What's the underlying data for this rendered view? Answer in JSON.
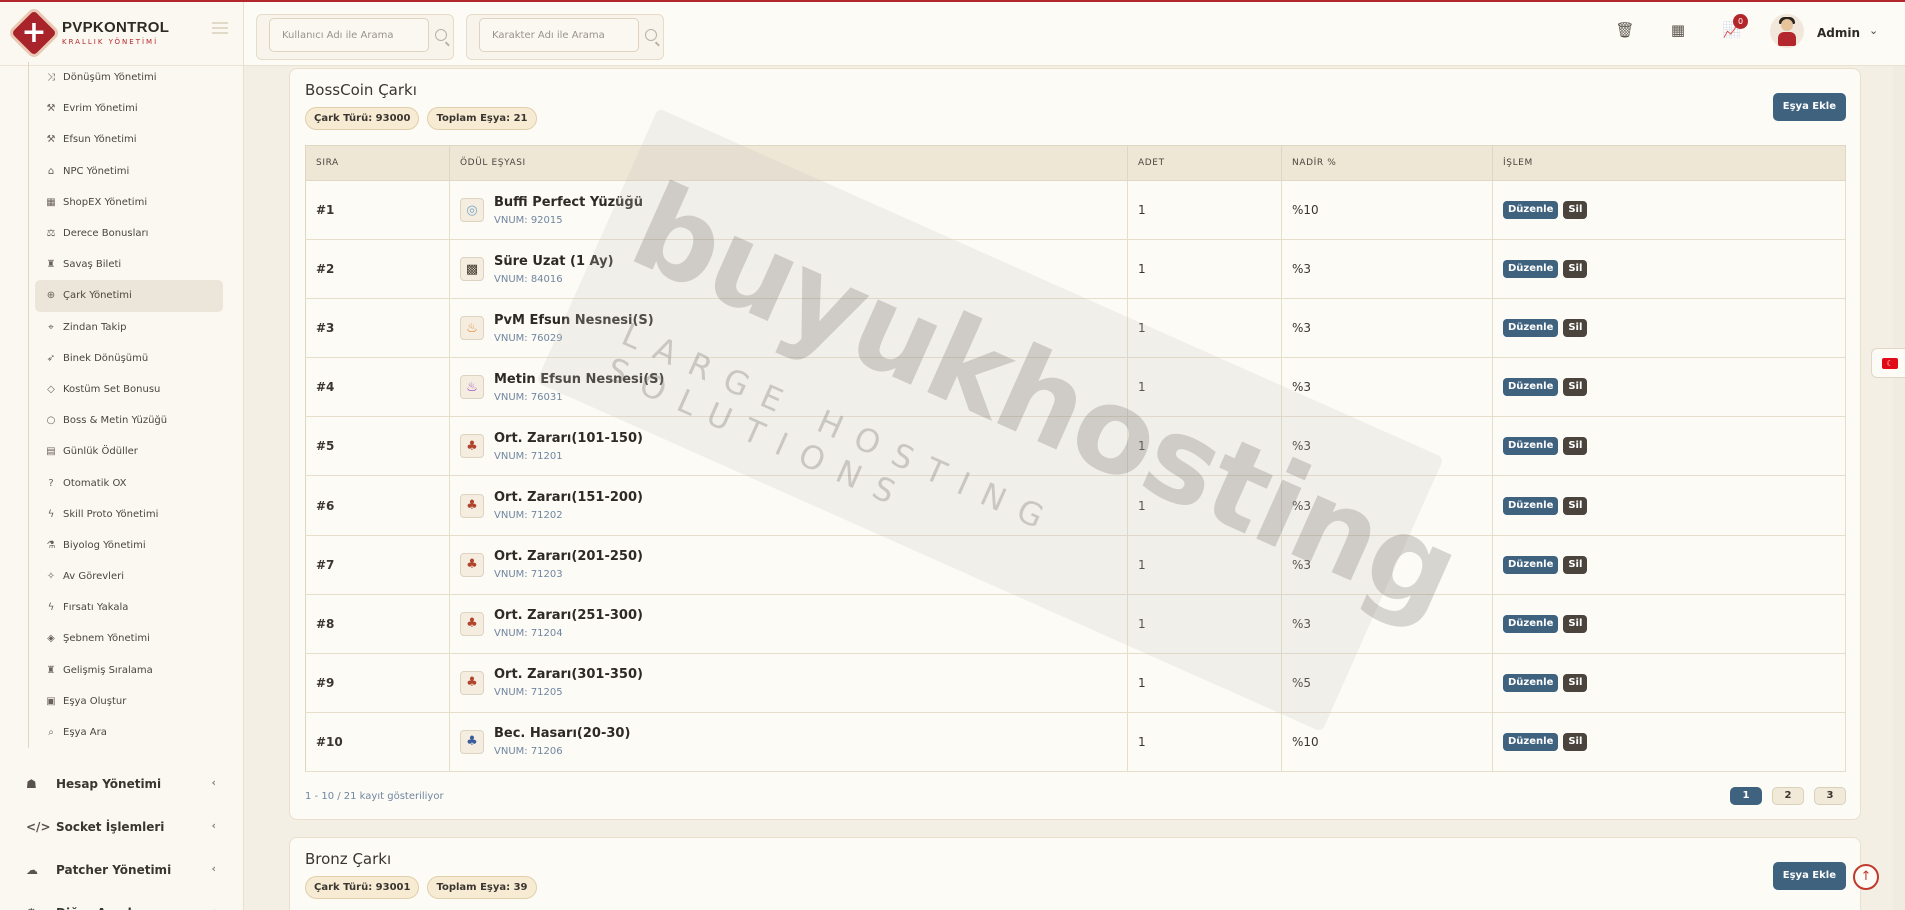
{
  "brand": {
    "name": "PVPKONTROL",
    "tagline": "KRALLIK YÖNETİMİ"
  },
  "search": {
    "user_placeholder": "Kullanıcı Adı ile Arama",
    "char_placeholder": "Karakter Adı ile Arama"
  },
  "header": {
    "notification_count": "0",
    "admin_name": "Admin"
  },
  "submenu": [
    {
      "label": "Dönüşüm Yönetimi",
      "icon": "shuffle-icon",
      "glyph": "⤨"
    },
    {
      "label": "Evrim Yönetimi",
      "icon": "wand-icon",
      "glyph": "⚒"
    },
    {
      "label": "Efsun Yönetimi",
      "icon": "wand-icon",
      "glyph": "⚒"
    },
    {
      "label": "NPC Yönetimi",
      "icon": "bank-icon",
      "glyph": "⌂"
    },
    {
      "label": "ShopEX Yönetimi",
      "icon": "shop-icon",
      "glyph": "▦"
    },
    {
      "label": "Derece Bonusları",
      "icon": "scale-icon",
      "glyph": "⚖"
    },
    {
      "label": "Savaş Bileti",
      "icon": "trophy-icon",
      "glyph": "♜"
    },
    {
      "label": "Çark Yönetimi",
      "icon": "globe-icon",
      "glyph": "⊕"
    },
    {
      "label": "Zindan Takip",
      "icon": "pin-icon",
      "glyph": "⌖"
    },
    {
      "label": "Binek Dönüşümü",
      "icon": "rocket-icon",
      "glyph": "➶"
    },
    {
      "label": "Kostüm Set Bonusu",
      "icon": "gem-icon",
      "glyph": "◇"
    },
    {
      "label": "Boss & Metin Yüzüğü",
      "icon": "ring-icon",
      "glyph": "○"
    },
    {
      "label": "Günlük Ödüller",
      "icon": "calendar-icon",
      "glyph": "▤"
    },
    {
      "label": "Otomatik OX",
      "icon": "question-icon",
      "glyph": "?"
    },
    {
      "label": "Skill Proto Yönetimi",
      "icon": "bolt-icon",
      "glyph": "ϟ"
    },
    {
      "label": "Biyolog Yönetimi",
      "icon": "flask-icon",
      "glyph": "⚗"
    },
    {
      "label": "Av Görevleri",
      "icon": "crosshair-icon",
      "glyph": "✧"
    },
    {
      "label": "Fırsatı Yakala",
      "icon": "bolt-icon",
      "glyph": "ϟ"
    },
    {
      "label": "Şebnem Yönetimi",
      "icon": "drop-icon",
      "glyph": "◈"
    },
    {
      "label": "Gelişmiş Sıralama",
      "icon": "trophy-icon",
      "glyph": "♜"
    },
    {
      "label": "Eşya Oluştur",
      "icon": "gift-icon",
      "glyph": "▣"
    },
    {
      "label": "Eşya Ara",
      "icon": "search-icon",
      "glyph": "⌕"
    }
  ],
  "active_submenu": "Çark Yönetimi",
  "mainmenu": [
    {
      "label": "Hesap Yönetimi",
      "icon": "users-icon",
      "glyph": "☗"
    },
    {
      "label": "Socket İşlemleri",
      "icon": "code-icon",
      "glyph": "</>"
    },
    {
      "label": "Patcher Yönetimi",
      "icon": "cloud-icon",
      "glyph": "☁"
    },
    {
      "label": "Diğer Ayarlar",
      "icon": "gear-icon",
      "glyph": "⚙"
    }
  ],
  "wheel1": {
    "title": "BossCoin Çarkı",
    "type_pill": "Çark Türü: 93000",
    "total_pill": "Toplam Eşya: 21",
    "add_label": "Eşya Ekle",
    "columns": [
      "SIRA",
      "ÖDÜL EŞYASI",
      "ADET",
      "NADİR %",
      "İŞLEM"
    ],
    "rows": [
      {
        "sira": "#1",
        "name": "Buffi Perfect Yüzüğü",
        "vnum": "VNUM: 92015",
        "adet": "1",
        "nadir": "%10",
        "icon": "ring-item-icon",
        "glyph": "◎",
        "color": "#7aa6c9"
      },
      {
        "sira": "#2",
        "name": "Süre Uzat (1 Ay)",
        "vnum": "VNUM: 84016",
        "adet": "1",
        "nadir": "%3",
        "icon": "scroll-item-icon",
        "glyph": "▩",
        "color": "#3f3a2c"
      },
      {
        "sira": "#3",
        "name": "PvM Efsun Nesnesi(S)",
        "vnum": "VNUM: 76029",
        "adet": "1",
        "nadir": "%3",
        "icon": "potion-orange-icon",
        "glyph": "♨",
        "color": "#e08a2d"
      },
      {
        "sira": "#4",
        "name": "Metin Efsun Nesnesi(S)",
        "vnum": "VNUM: 76031",
        "adet": "1",
        "nadir": "%3",
        "icon": "potion-purple-icon",
        "glyph": "♨",
        "color": "#9a3fc0"
      },
      {
        "sira": "#5",
        "name": "Ort. Zararı(101-150)",
        "vnum": "VNUM: 71201",
        "adet": "1",
        "nadir": "%3",
        "icon": "tree-item-icon",
        "glyph": "♣",
        "color": "#b0442c"
      },
      {
        "sira": "#6",
        "name": "Ort. Zararı(151-200)",
        "vnum": "VNUM: 71202",
        "adet": "1",
        "nadir": "%3",
        "icon": "tree-item-icon",
        "glyph": "♣",
        "color": "#b0442c"
      },
      {
        "sira": "#7",
        "name": "Ort. Zararı(201-250)",
        "vnum": "VNUM: 71203",
        "adet": "1",
        "nadir": "%3",
        "icon": "tree-item-icon",
        "glyph": "♣",
        "color": "#b0442c"
      },
      {
        "sira": "#8",
        "name": "Ort. Zararı(251-300)",
        "vnum": "VNUM: 71204",
        "adet": "1",
        "nadir": "%3",
        "icon": "tree-item-icon",
        "glyph": "♣",
        "color": "#b0442c"
      },
      {
        "sira": "#9",
        "name": "Ort. Zararı(301-350)",
        "vnum": "VNUM: 71205",
        "adet": "1",
        "nadir": "%5",
        "icon": "tree-item-icon",
        "glyph": "♣",
        "color": "#b0442c"
      },
      {
        "sira": "#10",
        "name": "Bec. Hasarı(20-30)",
        "vnum": "VNUM: 71206",
        "adet": "1",
        "nadir": "%10",
        "icon": "tree-blue-item-icon",
        "glyph": "♣",
        "color": "#3a5c9a"
      }
    ],
    "edit_label": "Düzenle",
    "delete_label": "Sil",
    "footer": "1 - 10 / 21 kayıt gösteriliyor",
    "pages": [
      "1",
      "2",
      "3"
    ],
    "active_page": "1"
  },
  "wheel2": {
    "title": "Bronz Çarkı",
    "type_pill": "Çark Türü: 93001",
    "total_pill": "Toplam Eşya: 39",
    "add_label": "Eşya Ekle"
  },
  "watermark": {
    "main": "buyukhosting",
    "sub": "LARGE HOSTING SOLUTIONS"
  },
  "language_flag": "☾"
}
